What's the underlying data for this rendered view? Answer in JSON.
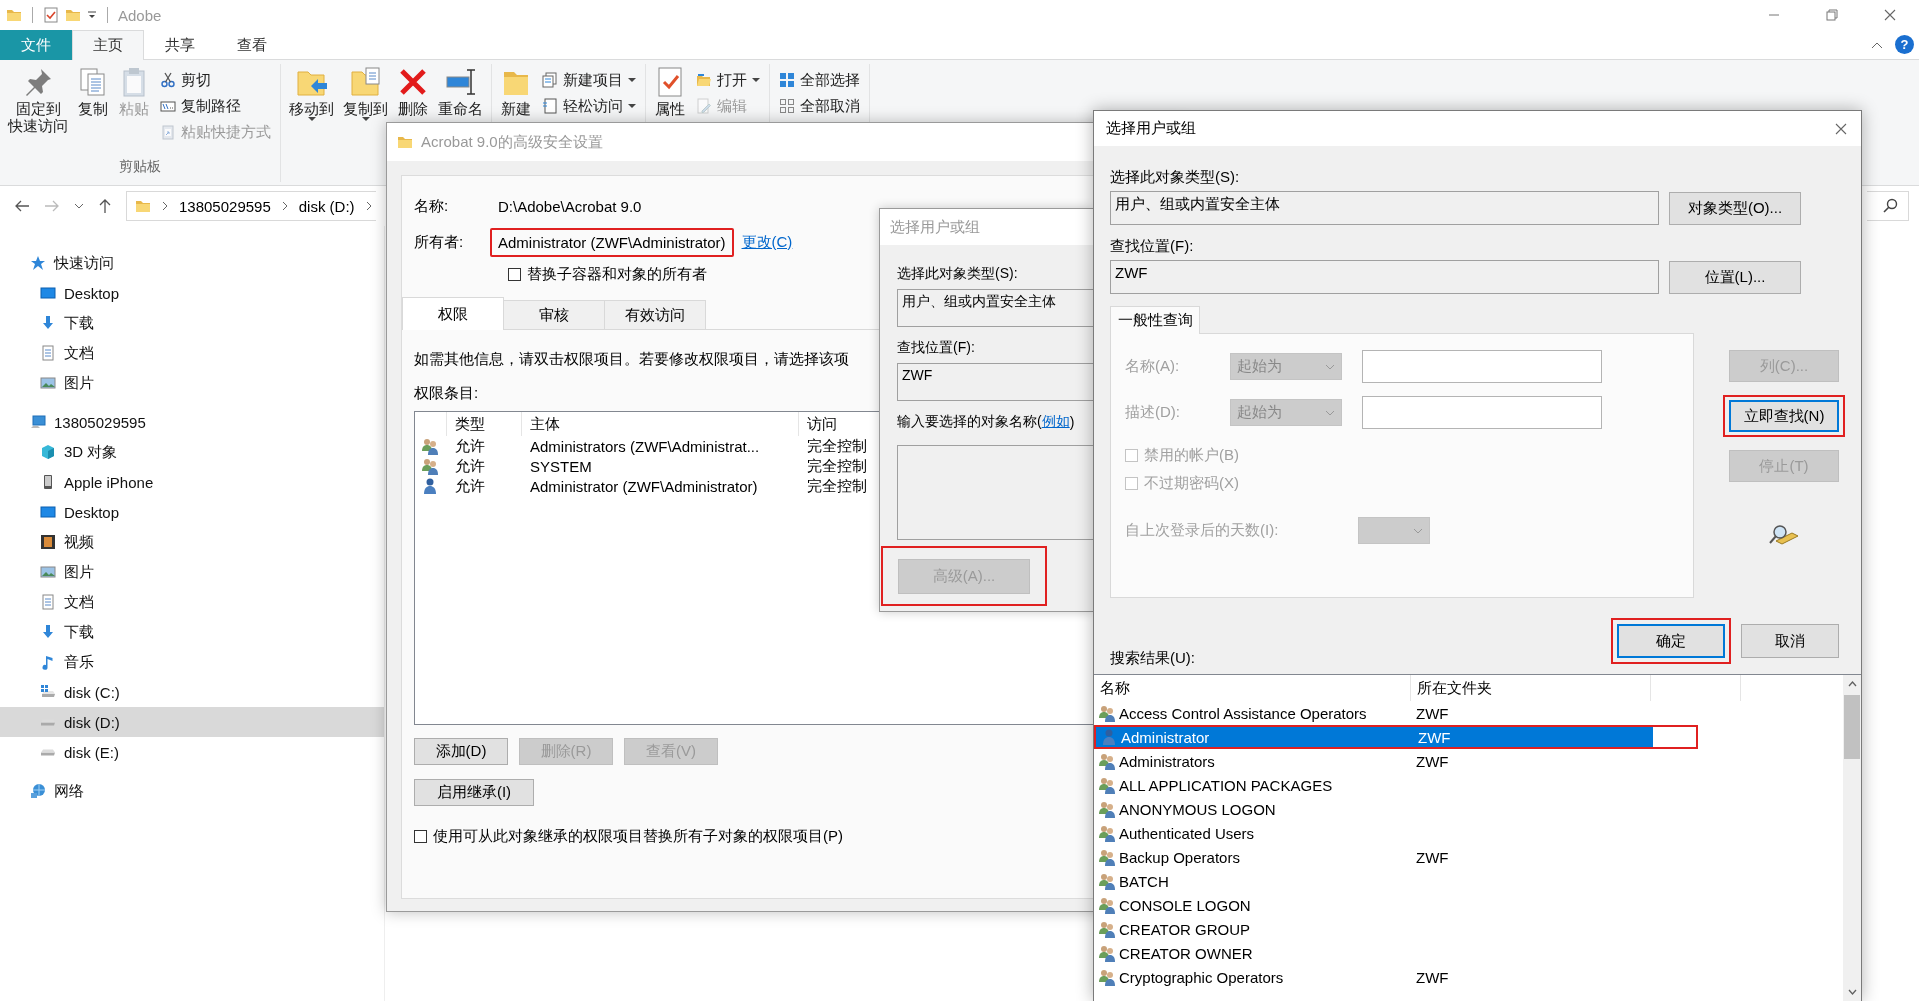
{
  "explorer": {
    "title": "Adobe",
    "help": "?",
    "ribbon_tabs": [
      {
        "label": "文件",
        "kind": "file",
        "selected": false
      },
      {
        "label": "主页",
        "kind": "tab",
        "selected": true
      },
      {
        "label": "共享",
        "kind": "tab",
        "selected": false
      },
      {
        "label": "查看",
        "kind": "tab",
        "selected": false
      }
    ],
    "ribbon_groups": [
      {
        "label": "剪贴板",
        "buttons": [
          {
            "label": "固定到",
            "label_line2": "快速访问",
            "kind": "pin",
            "large": true,
            "disabled": false
          },
          {
            "label": "复制",
            "kind": "copy",
            "large": true,
            "disabled": false
          },
          {
            "label": "粘贴",
            "kind": "paste",
            "large": true,
            "disabled": true
          },
          {
            "label": "剪切",
            "kind": "cut",
            "large": false,
            "disabled": false
          },
          {
            "label": "复制路径",
            "kind": "copy-path",
            "large": false,
            "disabled": false
          },
          {
            "label": "粘贴快捷方式",
            "kind": "paste-shortcut",
            "large": false,
            "disabled": true
          }
        ]
      },
      {
        "buttons": [
          {
            "label": "移动到",
            "kind": "move-to",
            "large": true,
            "disabled": false,
            "dropdown": true
          },
          {
            "label": "复制到",
            "kind": "copy-to",
            "large": true,
            "disabled": false,
            "dropdown": true
          },
          {
            "label": "删除",
            "kind": "delete",
            "large": true,
            "disabled": false
          },
          {
            "label": "重命名",
            "kind": "rename",
            "large": true,
            "disabled": false
          }
        ]
      },
      {
        "buttons": [
          {
            "label": "新建",
            "kind": "new-folder",
            "large": true,
            "disabled": false
          },
          {
            "label": "新建项目",
            "kind": "new-item",
            "large": false,
            "disabled": false,
            "dropdown": true
          },
          {
            "label": "轻松访问",
            "kind": "easy-access",
            "large": false,
            "disabled": false,
            "dropdown": true
          }
        ]
      },
      {
        "buttons": [
          {
            "label": "属性",
            "kind": "properties",
            "large": true,
            "disabled": false
          },
          {
            "label": "打开",
            "kind": "open",
            "large": false,
            "disabled": false,
            "dropdown": true
          },
          {
            "label": "编辑",
            "kind": "edit",
            "large": false,
            "disabled": true
          }
        ]
      },
      {
        "buttons": [
          {
            "label": "全部选择",
            "kind": "select-all",
            "large": false,
            "disabled": false
          },
          {
            "label": "全部取消",
            "kind": "select-none",
            "large": false,
            "disabled": false
          }
        ]
      }
    ],
    "address": {
      "breadcrumbs": [
        "13805029595",
        "disk (D:)"
      ]
    },
    "nav": [
      {
        "label": "快速访问",
        "kind": "star",
        "selected": false,
        "children": [
          {
            "label": "Desktop",
            "kind": "desktop",
            "selected": false
          },
          {
            "label": "下载",
            "kind": "download",
            "selected": false
          },
          {
            "label": "文档",
            "kind": "document",
            "selected": false
          },
          {
            "label": "图片",
            "kind": "picture",
            "selected": false
          }
        ]
      },
      {
        "label": "13805029595",
        "kind": "pc",
        "selected": false,
        "children": [
          {
            "label": "3D 对象",
            "kind": "cube",
            "selected": false
          },
          {
            "label": "Apple iPhone",
            "kind": "phone",
            "selected": false
          },
          {
            "label": "Desktop",
            "kind": "desktop",
            "selected": false
          },
          {
            "label": "视频",
            "kind": "video",
            "selected": false
          },
          {
            "label": "图片",
            "kind": "picture",
            "selected": false
          },
          {
            "label": "文档",
            "kind": "document",
            "selected": false
          },
          {
            "label": "下载",
            "kind": "download",
            "selected": false
          },
          {
            "label": "音乐",
            "kind": "music",
            "selected": false
          },
          {
            "label": "disk (C:)",
            "kind": "drive-c",
            "selected": false
          },
          {
            "label": "disk (D:)",
            "kind": "drive",
            "selected": true
          },
          {
            "label": "disk (E:)",
            "kind": "drive",
            "selected": false
          }
        ]
      },
      {
        "label": "网络",
        "kind": "network",
        "selected": false
      }
    ]
  },
  "security_dialog": {
    "title": "Acrobat 9.0的高级安全设置",
    "active": false,
    "name_label": "名称:",
    "name_value": "D:\\Adobe\\Acrobat 9.0",
    "owner_label": "所有者:",
    "owner": {
      "text": "Administrator (ZWF\\Administrator)",
      "highlighted": true
    },
    "change_link": "更改(C)",
    "replace_owner": {
      "label": "替换子容器和对象的所有者",
      "checked": false
    },
    "tabs": [
      {
        "label": "权限",
        "selected": true
      },
      {
        "label": "审核",
        "selected": false
      },
      {
        "label": "有效访问",
        "selected": false
      }
    ],
    "info_text": "如需其他信息，请双击权限项目。若要修改权限项目，请选择该项",
    "entries_label": "权限条目:",
    "table": {
      "columns": [
        "类型",
        "主体",
        "访问"
      ],
      "rows": [
        {
          "kind": "group",
          "cells": [
            "允许",
            "Administrators (ZWF\\Administrat...",
            "完全控制"
          ]
        },
        {
          "kind": "group",
          "cells": [
            "允许",
            "SYSTEM",
            "完全控制"
          ]
        },
        {
          "kind": "user",
          "cells": [
            "允许",
            "Administrator (ZWF\\Administrator)",
            "完全控制"
          ]
        }
      ]
    },
    "buttons": [
      {
        "label": "添加(D)",
        "disabled": false
      },
      {
        "label": "删除(R)",
        "disabled": true
      },
      {
        "label": "查看(V)",
        "disabled": true
      }
    ],
    "inherit_button": {
      "label": "启用继承(I)",
      "disabled": false
    },
    "replace_children": {
      "label": "使用可从此对象继承的权限项目替换所有子对象的权限项目(P)",
      "checked": false
    }
  },
  "picker_dialog_behind": {
    "title": "选择用户或组",
    "active": false,
    "object_type_label": "选择此对象类型(S):",
    "object_type": "用户、组或内置安全主体",
    "location_label": "查找位置(F):",
    "location": "ZWF",
    "names_prompt": {
      "before": "输入要选择的对象名称(",
      "link": "例如",
      "after": ")"
    },
    "advanced_button": {
      "label": "高级(A)...",
      "disabled": true,
      "highlighted": true
    }
  },
  "picker_dialog": {
    "title": "选择用户或组",
    "active": true,
    "object_type_label": "选择此对象类型(S):",
    "object_type": "用户、组或内置安全主体",
    "object_types_button": {
      "label": "对象类型(O)..."
    },
    "location_label": "查找位置(F):",
    "location": "ZWF",
    "locations_button": {
      "label": "位置(L)..."
    },
    "query_tab": {
      "label": "一般性查询"
    },
    "query_rows": [
      {
        "kind": "match",
        "label": "名称(A):",
        "mode": "起始为",
        "disabled": true
      },
      {
        "kind": "match",
        "label": "描述(D):",
        "mode": "起始为",
        "disabled": true
      },
      {
        "kind": "checkbox",
        "label": "禁用的帐户(B)",
        "checked": false,
        "disabled": true
      },
      {
        "kind": "checkbox",
        "label": "不过期密码(X)",
        "checked": false,
        "disabled": true
      },
      {
        "kind": "days",
        "label": "自上次登录后的天数(I):",
        "disabled": true
      }
    ],
    "side_buttons": [
      {
        "label": "列(C)...",
        "disabled": true,
        "default": false,
        "highlighted": false
      },
      {
        "label": "立即查找(N)",
        "disabled": false,
        "default": true,
        "highlighted": true
      },
      {
        "label": "停止(T)",
        "disabled": true,
        "default": false,
        "highlighted": false
      }
    ],
    "ok_button": {
      "label": "确定",
      "default": true,
      "highlighted": true
    },
    "cancel_button": {
      "label": "取消",
      "default": false,
      "highlighted": false
    },
    "results_label": "搜索结果(U):",
    "results": {
      "columns": [
        "名称",
        "所在文件夹"
      ],
      "rows": [
        {
          "name": "Access Control Assistance Operators",
          "folder": "ZWF",
          "kind": "group",
          "selected": false,
          "highlighted": false
        },
        {
          "name": "Administrator",
          "folder": "ZWF",
          "kind": "user",
          "selected": true,
          "highlighted": true
        },
        {
          "name": "Administrators",
          "folder": "ZWF",
          "kind": "group",
          "selected": false,
          "highlighted": false
        },
        {
          "name": "ALL APPLICATION PACKAGES",
          "kind": "group",
          "selected": false,
          "highlighted": false
        },
        {
          "name": "ANONYMOUS LOGON",
          "kind": "group",
          "selected": false,
          "highlighted": false
        },
        {
          "name": "Authenticated Users",
          "kind": "group",
          "selected": false,
          "highlighted": false
        },
        {
          "name": "Backup Operators",
          "folder": "ZWF",
          "kind": "group",
          "selected": false,
          "highlighted": false
        },
        {
          "name": "BATCH",
          "kind": "group",
          "selected": false,
          "highlighted": false
        },
        {
          "name": "CONSOLE LOGON",
          "kind": "group",
          "selected": false,
          "highlighted": false
        },
        {
          "name": "CREATOR GROUP",
          "kind": "group",
          "selected": false,
          "highlighted": false
        },
        {
          "name": "CREATOR OWNER",
          "kind": "group",
          "selected": false,
          "highlighted": false
        },
        {
          "name": "Cryptographic Operators",
          "folder": "ZWF",
          "kind": "group",
          "selected": false,
          "highlighted": false
        }
      ]
    }
  }
}
